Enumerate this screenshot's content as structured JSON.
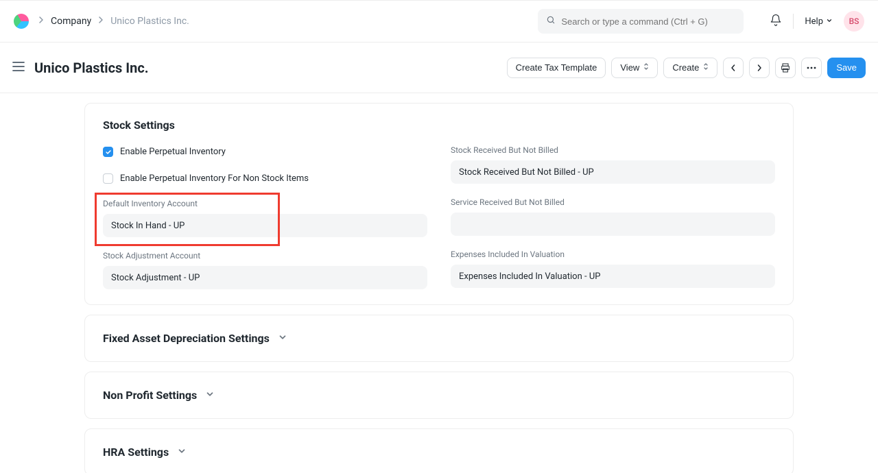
{
  "nav": {
    "breadcrumb_root": "Company",
    "breadcrumb_current": "Unico Plastics Inc.",
    "search_placeholder": "Search or type a command (Ctrl + G)",
    "help_label": "Help",
    "avatar_initials": "BS"
  },
  "header": {
    "title": "Unico Plastics Inc.",
    "actions": {
      "create_tax_template": "Create Tax Template",
      "view": "View",
      "create": "Create",
      "save": "Save"
    }
  },
  "stock_settings": {
    "section_title": "Stock Settings",
    "enable_perpetual_label": "Enable Perpetual Inventory",
    "enable_perpetual_checked": true,
    "enable_non_stock_label": "Enable Perpetual Inventory For Non Stock Items",
    "enable_non_stock_checked": false,
    "default_inventory_label": "Default Inventory Account",
    "default_inventory_value": "Stock In Hand - UP",
    "stock_adjustment_label": "Stock Adjustment Account",
    "stock_adjustment_value": "Stock Adjustment - UP",
    "stock_received_label": "Stock Received But Not Billed",
    "stock_received_value": "Stock Received But Not Billed - UP",
    "service_received_label": "Service Received But Not Billed",
    "service_received_value": "",
    "expenses_included_label": "Expenses Included In Valuation",
    "expenses_included_value": "Expenses Included In Valuation - UP"
  },
  "collapsed_sections": {
    "fixed_asset": "Fixed Asset Depreciation Settings",
    "non_profit": "Non Profit Settings",
    "hra": "HRA Settings"
  }
}
